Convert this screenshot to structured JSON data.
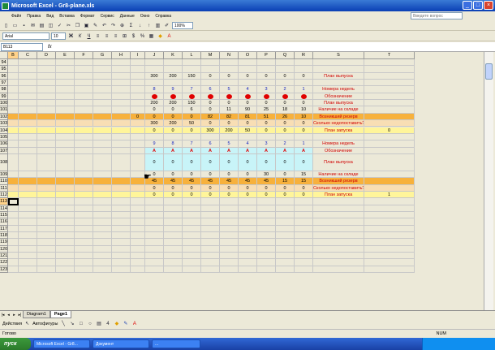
{
  "window": {
    "title": "Microsoft Excel - Gr8-plane.xls",
    "help_placeholder": "Введите вопрос"
  },
  "menu": [
    "Файл",
    "Правка",
    "Вид",
    "Вставка",
    "Формат",
    "Сервис",
    "Данные",
    "Окно",
    "Справка"
  ],
  "toolbar": {
    "zoom": "100%",
    "font": "Arial",
    "font_size": "10"
  },
  "formula": {
    "namebox": "B113",
    "fx": "fx",
    "value": ""
  },
  "columns": [
    "B",
    "C",
    "D",
    "E",
    "F",
    "G",
    "H",
    "I",
    "J",
    "K",
    "L",
    "M",
    "N",
    "O",
    "P",
    "Q",
    "R",
    "S",
    "T"
  ],
  "rows": [
    {
      "n": "94",
      "cells": [],
      "label": "",
      "style": ""
    },
    {
      "n": "95",
      "cells": [],
      "label": "",
      "style": ""
    },
    {
      "n": "96",
      "cells": [
        "300",
        "200",
        "150",
        "0",
        "0",
        "0",
        "0",
        "0",
        "0"
      ],
      "label": "План выпуска",
      "style": ""
    },
    {
      "n": "97",
      "cells": [],
      "label": "",
      "style": ""
    },
    {
      "n": "98",
      "cells": [
        "8",
        "9",
        "7",
        "6",
        "5",
        "4",
        "3",
        "2",
        "1"
      ],
      "label": "Номера недель",
      "style": "blue"
    },
    {
      "n": "99",
      "cells": [
        "dot",
        "dot",
        "dot",
        "dot",
        "dot",
        "dot",
        "dot",
        "dot",
        "dot"
      ],
      "label": "Обозначение",
      "style": ""
    },
    {
      "n": "100",
      "cells": [
        "200",
        "200",
        "150",
        "0",
        "0",
        "0",
        "0",
        "0",
        "0"
      ],
      "label": "План выпуска",
      "style": ""
    },
    {
      "n": "101",
      "cells": [
        "0",
        "0",
        "6",
        "0",
        "11",
        "90",
        "25",
        "18",
        "10"
      ],
      "label": "Наличие на складе",
      "style": ""
    },
    {
      "n": "102",
      "cells": [
        "0",
        "0",
        "0",
        "0",
        "82",
        "82",
        "81",
        "51",
        "26",
        "10"
      ],
      "label": "Возникший резерв",
      "style": "orange"
    },
    {
      "n": "103",
      "cells": [
        "300",
        "200",
        "50",
        "0",
        "0",
        "0",
        "0",
        "0",
        "0"
      ],
      "label": "Сколько недопоставить?",
      "style": "pale"
    },
    {
      "n": "104",
      "cells": [
        "0",
        "0",
        "0",
        "300",
        "200",
        "50",
        "0",
        "0",
        "0"
      ],
      "label": "План запуска",
      "style": "yellow",
      "extra": "0"
    },
    {
      "n": "105",
      "cells": [],
      "label": "",
      "style": ""
    },
    {
      "n": "106",
      "cells": [
        "9",
        "8",
        "7",
        "6",
        "5",
        "4",
        "3",
        "2",
        "1"
      ],
      "label": "Номера недель",
      "style": "blue"
    },
    {
      "n": "107",
      "cells": [
        "tri",
        "tri",
        "tri",
        "tri",
        "tri",
        "tri",
        "tri",
        "tri",
        "tri"
      ],
      "label": "Обозначение",
      "style": "cyan"
    },
    {
      "n": "108",
      "cells": [
        "0",
        "0",
        "0",
        "0",
        "0",
        "0",
        "0",
        "0",
        "0"
      ],
      "label": "План выпуска",
      "style": "cyan",
      "tall": true
    },
    {
      "n": "109",
      "cells": [
        "0",
        "0",
        "0",
        "0",
        "0",
        "0",
        "30",
        "0",
        "15"
      ],
      "label": "Наличие на складе",
      "style": ""
    },
    {
      "n": "110",
      "cells": [
        "45",
        "45",
        "45",
        "45",
        "45",
        "45",
        "45",
        "15",
        "15"
      ],
      "label": "Возникший резерв",
      "style": "orange"
    },
    {
      "n": "111",
      "cells": [
        "0",
        "0",
        "0",
        "0",
        "0",
        "0",
        "0",
        "0",
        "0"
      ],
      "label": "Сколько недопоставить?",
      "style": "pale"
    },
    {
      "n": "112",
      "cells": [
        "0",
        "0",
        "0",
        "0",
        "0",
        "0",
        "0",
        "0",
        "0"
      ],
      "label": "План запуска",
      "style": "yellow",
      "extra": "1"
    },
    {
      "n": "113",
      "cells": [],
      "label": "",
      "style": "sel"
    },
    {
      "n": "114",
      "cells": [],
      "label": "",
      "style": ""
    },
    {
      "n": "115",
      "cells": [],
      "label": "",
      "style": ""
    },
    {
      "n": "116",
      "cells": [],
      "label": "",
      "style": ""
    },
    {
      "n": "117",
      "cells": [],
      "label": "",
      "style": ""
    },
    {
      "n": "118",
      "cells": [],
      "label": "",
      "style": ""
    },
    {
      "n": "119",
      "cells": [],
      "label": "",
      "style": ""
    },
    {
      "n": "120",
      "cells": [],
      "label": "",
      "style": ""
    },
    {
      "n": "121",
      "cells": [],
      "label": "",
      "style": ""
    },
    {
      "n": "122",
      "cells": [],
      "label": "",
      "style": ""
    },
    {
      "n": "123",
      "cells": [],
      "label": "",
      "style": ""
    }
  ],
  "sheets": [
    "Diagram1",
    "Page1"
  ],
  "drawing": {
    "actions": "Действия",
    "autoshapes": "Автофигуры"
  },
  "status": {
    "ready": "Готово",
    "num": "NUM"
  },
  "taskbar": {
    "start": "пуск",
    "items": [
      "Microsoft Excel - Gr8...",
      "Документ",
      "..."
    ]
  }
}
